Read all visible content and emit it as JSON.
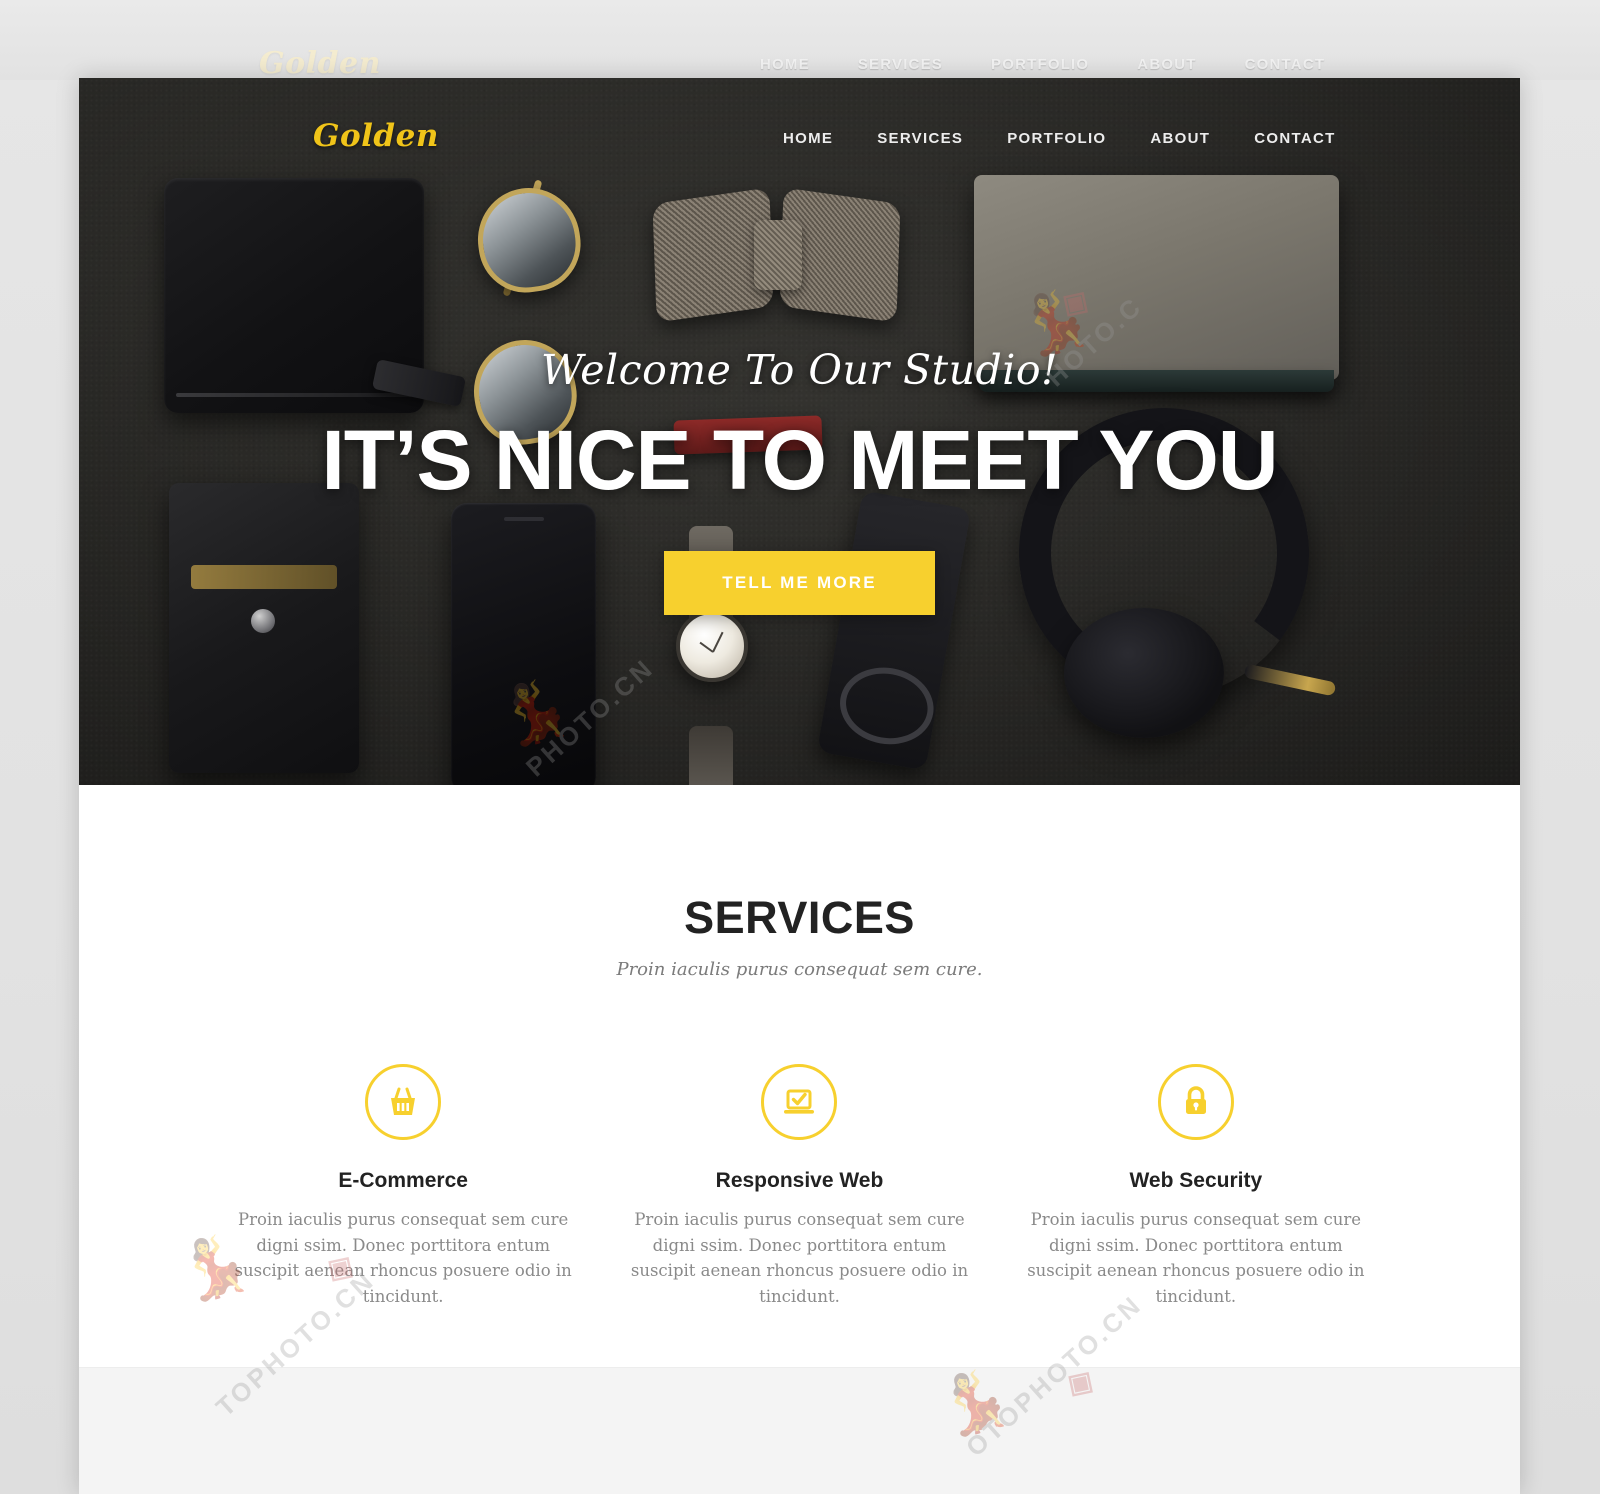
{
  "brand": {
    "logo_text": "Golden",
    "accent_color": "#f7d02e",
    "logo_color": "#f0c419"
  },
  "sticky_nav": {
    "logo_text": "Golden",
    "items": [
      {
        "label": "HOME"
      },
      {
        "label": "SERVICES"
      },
      {
        "label": "PORTFOLIO"
      },
      {
        "label": "ABOUT"
      },
      {
        "label": "CONTACT"
      }
    ]
  },
  "hero": {
    "logo_text": "Golden",
    "nav": [
      {
        "label": "HOME"
      },
      {
        "label": "SERVICES"
      },
      {
        "label": "PORTFOLIO"
      },
      {
        "label": "ABOUT"
      },
      {
        "label": "CONTACT"
      }
    ],
    "subtitle": "Welcome To Our Studio!",
    "title": "IT’S NICE TO MEET YOU",
    "cta_label": "TELL ME MORE",
    "cta_bg": "#f7d02e",
    "background_description": "flat-lay photo of dark desk with wallet, sunglasses, bow tie, notebook, card holder, phone, watch, eyeglasses and headphones"
  },
  "services": {
    "title": "SERVICES",
    "subtitle": "Proin iaculis purus consequat sem cure.",
    "cards": [
      {
        "icon": "shopping-basket-icon",
        "title": "E-Commerce",
        "text": "Proin iaculis purus consequat sem cure digni ssim. Donec porttitora entum suscipit aenean rhoncus posuere odio in tincidunt."
      },
      {
        "icon": "laptop-check-icon",
        "title": "Responsive Web",
        "text": "Proin iaculis purus consequat sem cure digni ssim. Donec porttitora entum suscipit aenean rhoncus posuere odio in tincidunt."
      },
      {
        "icon": "lock-icon",
        "title": "Web Security",
        "text": "Proin iaculis purus consequat sem cure digni ssim. Donec porttitora entum suscipit aenean rhoncus posuere odio in tincidunt."
      }
    ]
  },
  "watermark": {
    "text_1": "TOPHOTO.CN",
    "text_2": "PHOTO.CN",
    "text_3": "OTOPHOTO.CN",
    "text_4": "HOTO.C"
  }
}
